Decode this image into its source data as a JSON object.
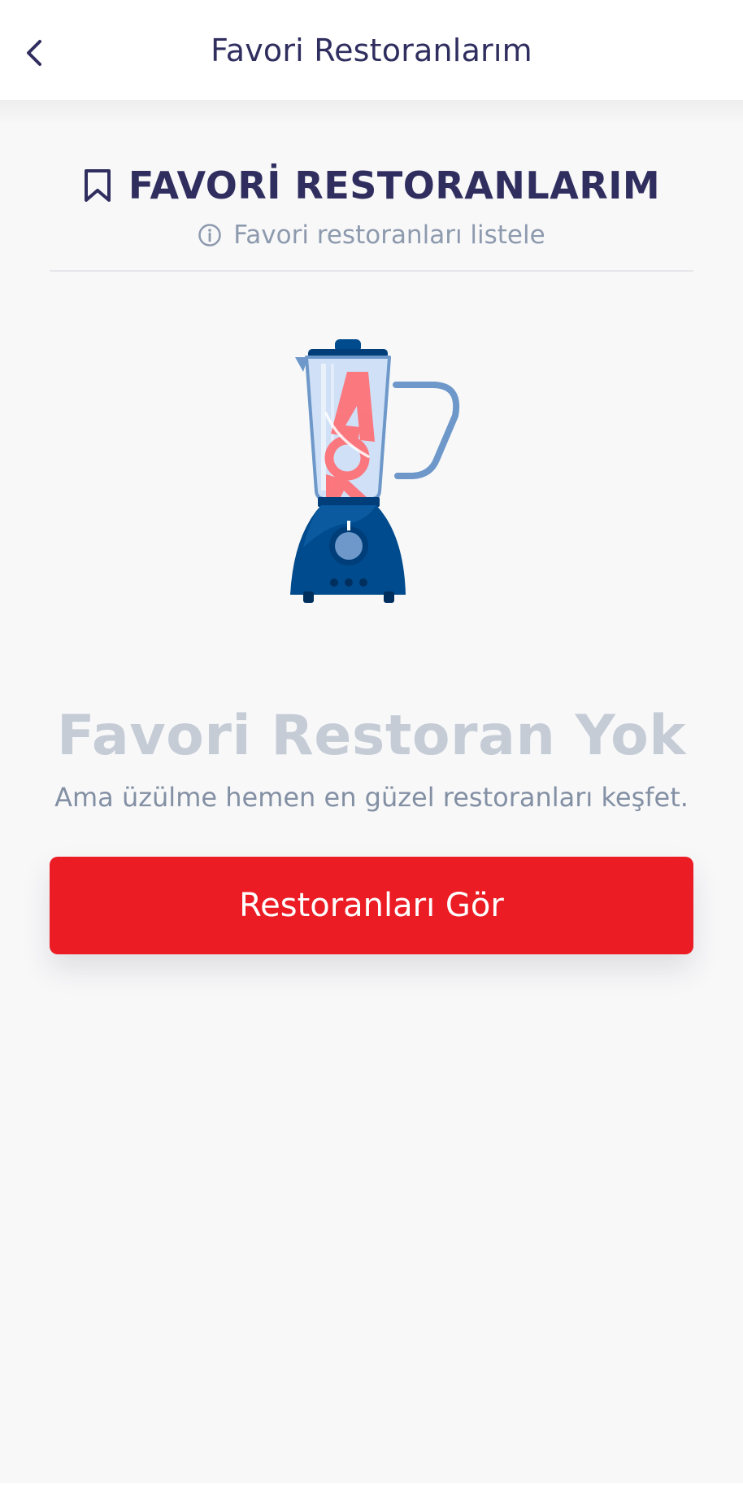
{
  "header": {
    "title": "Favori Restoranlarım",
    "back_icon": "chevron-left-icon"
  },
  "section": {
    "title": "FAVORİ RESTORANLARIM",
    "subtitle": "Favori restoranları listele",
    "title_icon": "bookmark-icon",
    "subtitle_icon": "info-icon"
  },
  "empty_state": {
    "illustration": "blender-illustration",
    "title": "Favori Restoran Yok",
    "description": "Ama üzülme hemen en güzel restoranları keşfet."
  },
  "cta": {
    "label": "Restoranları Gör"
  },
  "colors": {
    "primary_red": "#eb1c24",
    "navy_text": "#2f2e5f",
    "muted_text": "#8d9aae",
    "empty_title": "#c5ccd6",
    "background": "#f8f8f9"
  }
}
